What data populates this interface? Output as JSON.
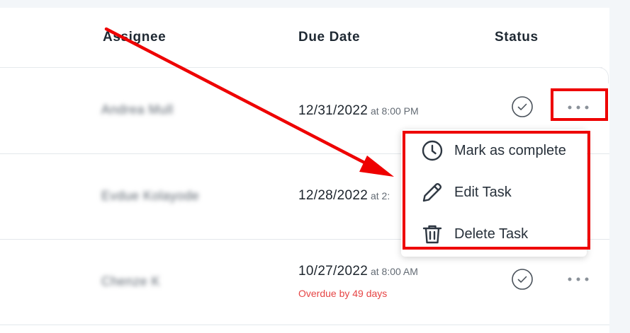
{
  "columns": {
    "assignee": "Assignee",
    "due_date": "Due Date",
    "status": "Status"
  },
  "rows": [
    {
      "assignee": "Andrea Mull",
      "date": "12/31/2022",
      "time": " at 8:00 PM",
      "overdue": ""
    },
    {
      "assignee": "Evdue Kolayode",
      "date": "12/28/2022",
      "time": " at 2:",
      "overdue": ""
    },
    {
      "assignee": "Chenze K",
      "date": "10/27/2022",
      "time": " at 8:00 AM",
      "overdue": "Overdue by 49 days"
    }
  ],
  "menu": {
    "items": [
      {
        "label": "Mark as complete",
        "icon": "clock-icon"
      },
      {
        "label": "Edit Task",
        "icon": "pencil-icon"
      },
      {
        "label": "Delete Task",
        "icon": "trash-icon"
      }
    ]
  },
  "annotation": {
    "color": "#ee0000"
  }
}
